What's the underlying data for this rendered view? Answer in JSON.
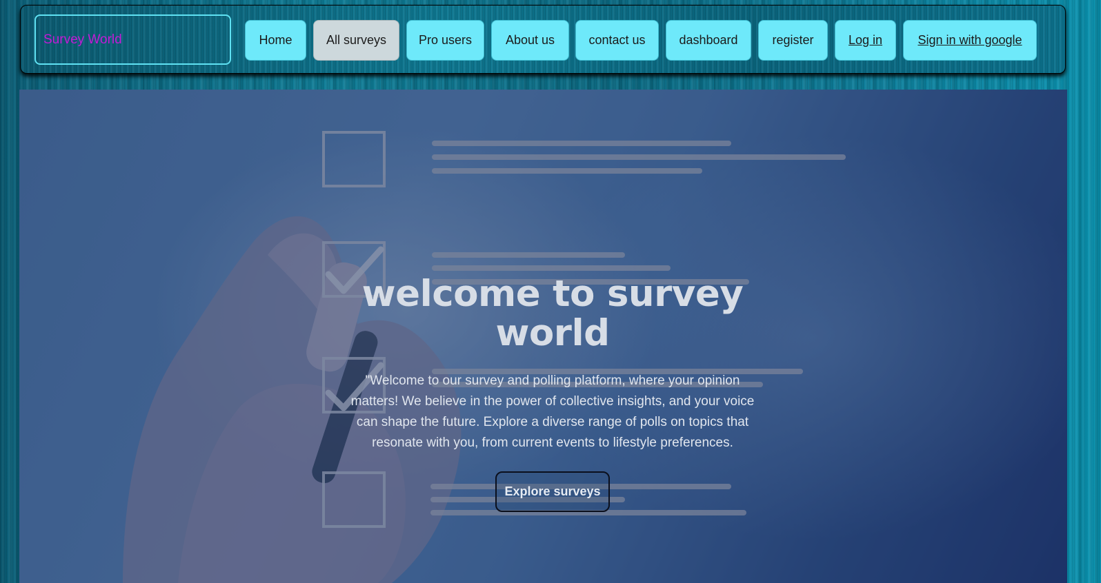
{
  "brand": {
    "name": "Survey World"
  },
  "nav": {
    "items": [
      {
        "label": "Home",
        "state": "default"
      },
      {
        "label": "All surveys",
        "state": "active"
      },
      {
        "label": "Pro users",
        "state": "default"
      },
      {
        "label": "About us",
        "state": "default"
      },
      {
        "label": "contact us",
        "state": "default"
      },
      {
        "label": "dashboard",
        "state": "default"
      },
      {
        "label": "register",
        "state": "default"
      },
      {
        "label": "Log in",
        "state": "link"
      },
      {
        "label": "Sign in with google",
        "state": "link"
      }
    ]
  },
  "hero": {
    "title": "welcome to survey world",
    "description": "\"Welcome to our survey and polling platform, where your opinion matters! We believe in the power of collective insights, and your voice can shape the future. Explore a diverse range of polls on topics that resonate with you, from current events to lifestyle preferences.",
    "cta_label": "Explore surveys",
    "background_image": "hand-drawing-checklist"
  },
  "colors": {
    "nav_button": "#6ee9fa",
    "nav_button_active": "#cdd8dc",
    "brand_text": "#c41ad6",
    "brand_border": "#5fe2f3"
  }
}
